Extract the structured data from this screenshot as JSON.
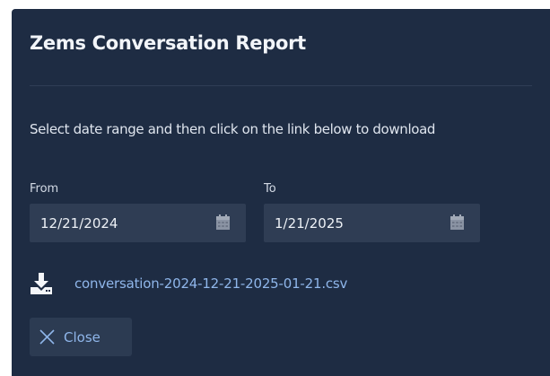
{
  "dialog": {
    "title": "Zems Conversation Report",
    "instructions": "Select date range and then click on the link below to download"
  },
  "from_field": {
    "label": "From",
    "value": "12/21/2024",
    "icon": "calendar-icon"
  },
  "to_field": {
    "label": "To",
    "value": "1/21/2025",
    "icon": "calendar-icon"
  },
  "download": {
    "icon": "download-icon",
    "filename": "conversation-2024-12-21-2025-01-21.csv"
  },
  "close_button": {
    "icon": "close-icon",
    "label": "Close"
  },
  "colors": {
    "dialog_background": "#1e2c43",
    "field_background": "#2f3d54",
    "link": "#8fb6ea",
    "text": "#e4e9f0"
  }
}
